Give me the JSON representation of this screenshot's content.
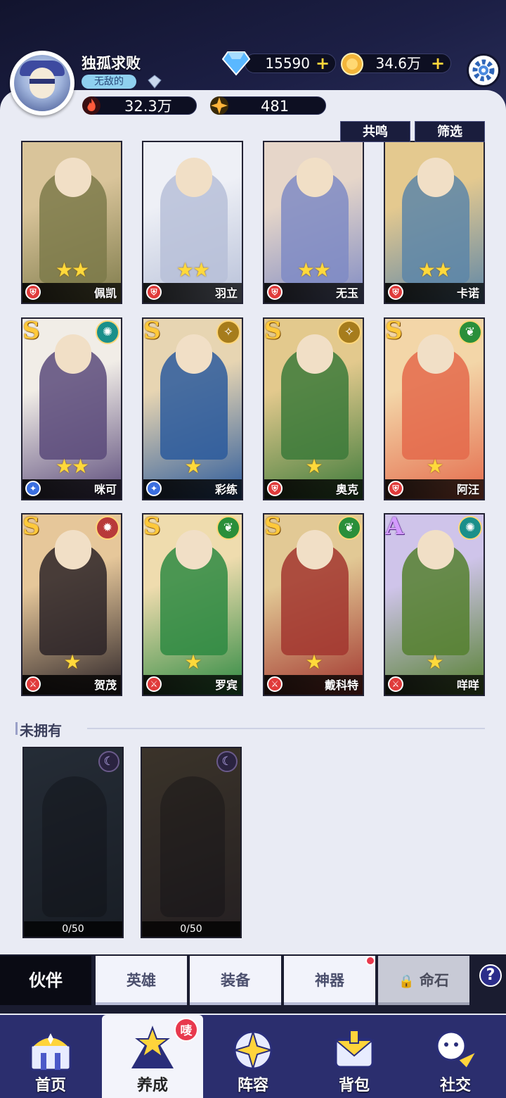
{
  "player": {
    "name": "独孤求败",
    "title": "无敌的",
    "power": "32.3万",
    "stamina": "481"
  },
  "resources": {
    "diamonds": "15590",
    "gold": "34.6万"
  },
  "filters": {
    "resonance": "共鸣",
    "filter": "筛选"
  },
  "owned_heroes": [
    {
      "name": "佩凯",
      "grade": "",
      "stars": 2,
      "class_icon": "shield-icon",
      "element_icon": "",
      "colors": [
        "#d9c49a",
        "#7d7a4a"
      ]
    },
    {
      "name": "羽立",
      "grade": "",
      "stars": 2,
      "class_icon": "shield-icon",
      "element_icon": "",
      "colors": [
        "#eef0f6",
        "#b7c0d8"
      ]
    },
    {
      "name": "无玉",
      "grade": "",
      "stars": 2,
      "class_icon": "shield-icon",
      "element_icon": "",
      "colors": [
        "#e6d6c9",
        "#7f8bc4"
      ]
    },
    {
      "name": "卡诺",
      "grade": "",
      "stars": 2,
      "class_icon": "shield-icon",
      "element_icon": "",
      "colors": [
        "#e4c98f",
        "#5d86a8"
      ]
    },
    {
      "name": "咪可",
      "grade": "S",
      "stars": 2,
      "class_icon": "magic-icon",
      "element_icon": "wind-icon",
      "colors": [
        "#f1ede7",
        "#5a4a7a"
      ]
    },
    {
      "name": "彩练",
      "grade": "S",
      "stars": 1,
      "class_icon": "magic-icon",
      "element_icon": "light-icon",
      "colors": [
        "#e7d5b2",
        "#2b5a9c"
      ]
    },
    {
      "name": "奥克",
      "grade": "S",
      "stars": 1,
      "class_icon": "shield-icon",
      "element_icon": "light-icon",
      "colors": [
        "#e3c98d",
        "#3c7a3a"
      ]
    },
    {
      "name": "阿汪",
      "grade": "S",
      "stars": 1,
      "class_icon": "shield-icon",
      "element_icon": "nature-icon",
      "colors": [
        "#f3d6a8",
        "#e46a4b"
      ]
    },
    {
      "name": "贺茂",
      "grade": "S",
      "stars": 1,
      "class_icon": "sword-icon",
      "element_icon": "fire-icon",
      "colors": [
        "#e6c79a",
        "#2b2327"
      ]
    },
    {
      "name": "罗宾",
      "grade": "S",
      "stars": 1,
      "class_icon": "sword-icon",
      "element_icon": "nature-icon",
      "colors": [
        "#efdcae",
        "#2e8a42"
      ]
    },
    {
      "name": "戴科特",
      "grade": "S",
      "stars": 1,
      "class_icon": "sword-icon",
      "element_icon": "nature-icon",
      "colors": [
        "#e2c995",
        "#a2362f"
      ]
    },
    {
      "name": "咩咩",
      "grade": "A",
      "stars": 1,
      "class_icon": "sword-icon",
      "element_icon": "wind-icon",
      "colors": [
        "#cfc4ea",
        "#55802f"
      ]
    }
  ],
  "unowned_section": {
    "title": "未拥有",
    "heroes": [
      {
        "progress": "0/50",
        "element_icon": "moon-icon"
      },
      {
        "progress": "0/50",
        "element_icon": "moon-icon"
      }
    ]
  },
  "sub_tabs": [
    {
      "label": "伙伴",
      "active": true
    },
    {
      "label": "英雄"
    },
    {
      "label": "装备"
    },
    {
      "label": "神器",
      "notice": true
    },
    {
      "label": "命石",
      "locked": true
    }
  ],
  "bottom_nav": [
    {
      "label": "首页"
    },
    {
      "label": "养成",
      "active": true,
      "badge": "唛"
    },
    {
      "label": "阵容"
    },
    {
      "label": "背包"
    },
    {
      "label": "社交"
    }
  ],
  "colors": {
    "accent_gold": "#ffd43b",
    "header_dark": "#12142e",
    "nav_blue": "#2b2e6e",
    "alert_red": "#e8394d"
  }
}
